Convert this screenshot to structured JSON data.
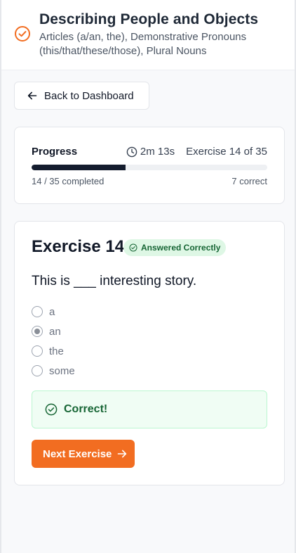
{
  "header": {
    "title": "Describing People and Objects",
    "subtitle": "Articles (a/an, the), Demonstrative Pronouns (this/that/these/those), Plural Nouns",
    "icon": "check-circle-icon",
    "accent_color": "#f26d21"
  },
  "nav": {
    "back_label": "Back to Dashboard"
  },
  "progress": {
    "label": "Progress",
    "timer": "2m 13s",
    "exercise_count": "Exercise 14 of 35",
    "completed_text": "14 / 35 completed",
    "correct_text": "7 correct",
    "fraction": 0.4
  },
  "exercise": {
    "title": "Exercise 14",
    "badge": "Answered Correctly",
    "question": "This is ___ interesting story.",
    "options": [
      {
        "label": "a",
        "checked": false
      },
      {
        "label": "an",
        "checked": true
      },
      {
        "label": "the",
        "checked": false
      },
      {
        "label": "some",
        "checked": false
      }
    ],
    "feedback": "Correct!",
    "next_label": "Next Exercise"
  }
}
